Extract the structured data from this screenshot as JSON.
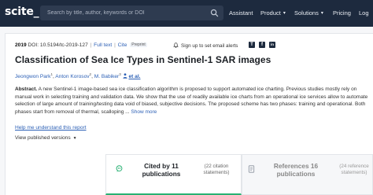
{
  "header": {
    "logo": "scite_",
    "search_placeholder": "Search by title, author, keywords or DOI",
    "nav": {
      "assistant": "Assistant",
      "product": "Product",
      "solutions": "Solutions",
      "pricing": "Pricing",
      "login": "Log"
    }
  },
  "paper": {
    "year": "2019",
    "doi_label": "DOI: 10.5194/tc-2019-127",
    "full_text": "Full text",
    "cite": "Cite",
    "badge": "Preprint",
    "alert": "Sign up to set email alerts",
    "social": [
      "T",
      "f",
      "in"
    ],
    "title": "Classification of Sea Ice Types in Sentinel-1 SAR images",
    "authors": [
      {
        "name": "Jeongwon Park",
        "sup": "1"
      },
      {
        "name": "Anton Korosov",
        "sup": "2"
      },
      {
        "name": "M. Babiker",
        "sup": "3"
      }
    ],
    "et_al": "et al.",
    "abstract_label": "Abstract.",
    "abstract_text": "A new Sentinel-1 image-based sea ice classification algorithm is proposed to support automated ice charting. Previous studies mostly rely on manual work in selecting training and validation data. We show that the use of readily available ice charts from an operational ice services allow to automate selection of large amount of training/testing data void of biased, subjective decisions. The proposed scheme has two phases: training and operational. Both phases start from removal of thermal, scalloping ...",
    "show_more": "Show more",
    "understand": "Help me understand this report",
    "versions": "View published versions"
  },
  "tabs": {
    "cited": {
      "main": "Cited by 11 publications",
      "sub": "(22 citation statements)"
    },
    "references": {
      "main": "References 16 publications",
      "sub": "(24 reference statements)"
    }
  },
  "colors": {
    "header_bg": "#1d2a3e",
    "link": "#2b5fb5",
    "accent_green": "#29b173"
  }
}
